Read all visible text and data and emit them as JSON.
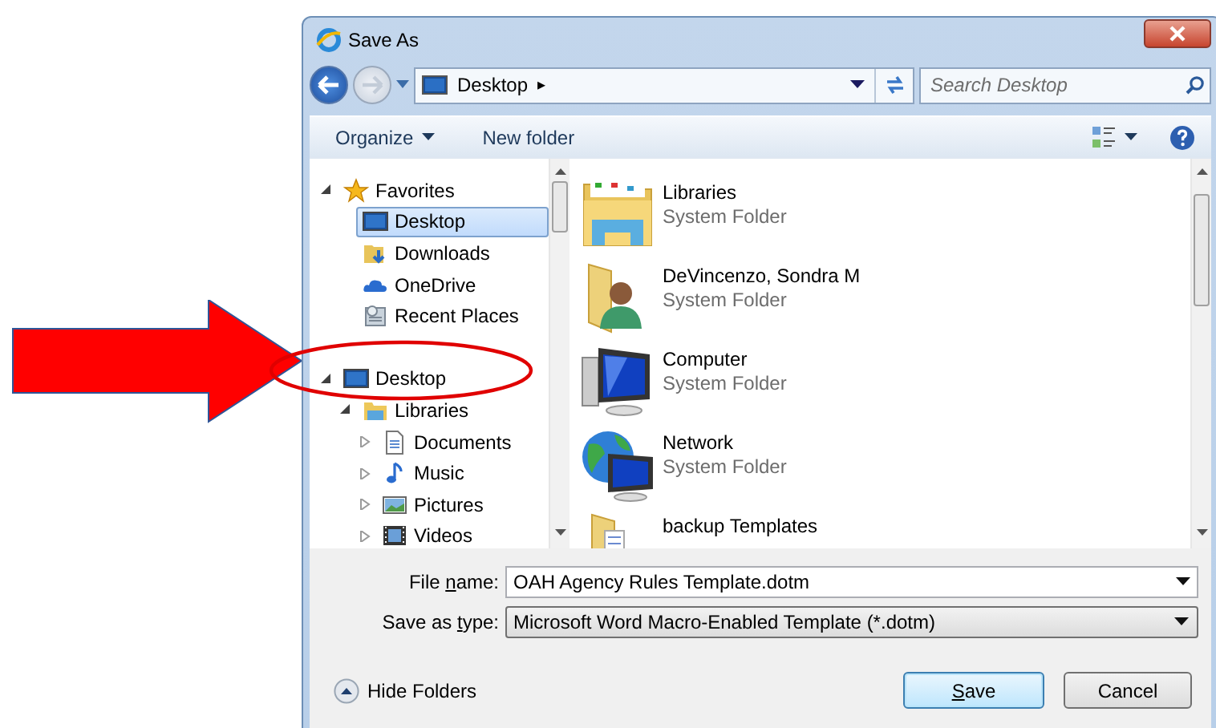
{
  "window": {
    "title": "Save As"
  },
  "address": {
    "location": "Desktop",
    "separator": "▸"
  },
  "search": {
    "placeholder": "Search Desktop"
  },
  "toolbar": [
    {
      "label": "Organize",
      "dropdown": true
    },
    {
      "label": "New folder",
      "dropdown": false
    }
  ],
  "nav": {
    "items": [
      {
        "label": "Favorites",
        "kind": "star",
        "expanded": true,
        "selected": false,
        "children": [
          {
            "label": "Desktop",
            "kind": "desktop",
            "selected": true
          },
          {
            "label": "Downloads",
            "kind": "downloads",
            "selected": false
          },
          {
            "label": "OneDrive",
            "kind": "cloud",
            "selected": false
          },
          {
            "label": "Recent Places",
            "kind": "recent",
            "selected": false
          }
        ]
      },
      {
        "label": "Desktop",
        "kind": "desktop",
        "expanded": true,
        "selected": false,
        "children": [
          {
            "label": "Libraries",
            "kind": "library",
            "expanded": true,
            "selected": false,
            "children": [
              {
                "label": "Documents",
                "kind": "document",
                "expanded": false,
                "selected": false
              },
              {
                "label": "Music",
                "kind": "music",
                "expanded": false,
                "selected": false
              },
              {
                "label": "Pictures",
                "kind": "pictures",
                "expanded": false,
                "selected": false
              },
              {
                "label": "Videos",
                "kind": "videos",
                "expanded": false,
                "selected": false
              }
            ]
          }
        ]
      }
    ]
  },
  "content": [
    {
      "name": "Libraries",
      "detail": "System Folder",
      "kind": "library"
    },
    {
      "name": "DeVincenzo, Sondra M",
      "detail": "System Folder",
      "kind": "user"
    },
    {
      "name": "Computer",
      "detail": "System Folder",
      "kind": "computer"
    },
    {
      "name": "Network",
      "detail": "System Folder",
      "kind": "network"
    },
    {
      "name": "backup Templates",
      "kind": "folder"
    }
  ],
  "fields": [
    {
      "label": {
        "before": "File ",
        "key": "n",
        "after": "ame:"
      },
      "value": "OAH Agency Rules Template.dotm",
      "kind": "combo"
    },
    {
      "label": {
        "before": "Save as ",
        "key": "t",
        "after": "ype:"
      },
      "value": "Microsoft Word Macro-Enabled Template (*.dotm)",
      "kind": "select"
    }
  ],
  "hide_folders": {
    "label": "Hide Folders"
  },
  "buttons": [
    {
      "label": {
        "key": "S",
        "after": "ave"
      },
      "default": true
    },
    {
      "label": {
        "before": "Cancel"
      },
      "default": false
    }
  ]
}
